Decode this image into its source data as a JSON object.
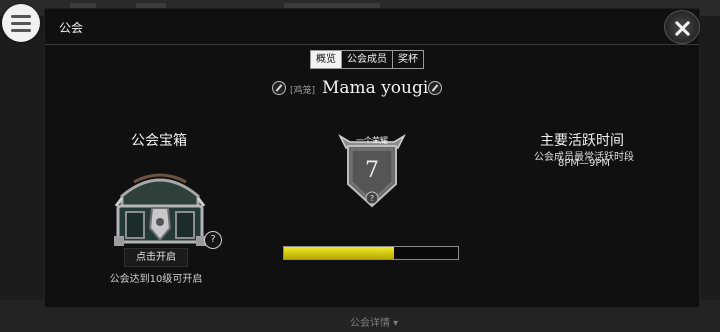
{
  "panel": {
    "title": "公会"
  },
  "tabs": [
    {
      "label": "概览",
      "active": true
    },
    {
      "label": "公会成员",
      "active": false
    },
    {
      "label": "奖杯",
      "active": false
    }
  ],
  "guild": {
    "tag": "[鸡笼]",
    "name": "Mama yougi"
  },
  "treasure": {
    "title": "公会宝箱",
    "open_button": "点击开启",
    "note": "公会达到10级可开启",
    "help": "?"
  },
  "rank": {
    "banner_label": "一个荣耀",
    "level": "7",
    "help": "?",
    "progress_fraction": 0.63,
    "progress_color": "#f0ea2a"
  },
  "activity": {
    "title": "主要活跃时间",
    "subtitle": "公会成员最常活跃时段",
    "time": "8PM—9PM"
  },
  "footer": {
    "details_label": "公会详情 ▾"
  },
  "icons": {
    "menu": "hamburger-menu-icon",
    "close": "close-icon",
    "edit": "pencil-icon",
    "help": "question-icon",
    "chest": "treasure-chest-icon",
    "badge": "guild-shield-badge-icon"
  },
  "colors": {
    "panel_bg": "#101010",
    "progress_fill": "#f0ea2a",
    "tab_active_bg": "#f2f2f2"
  }
}
